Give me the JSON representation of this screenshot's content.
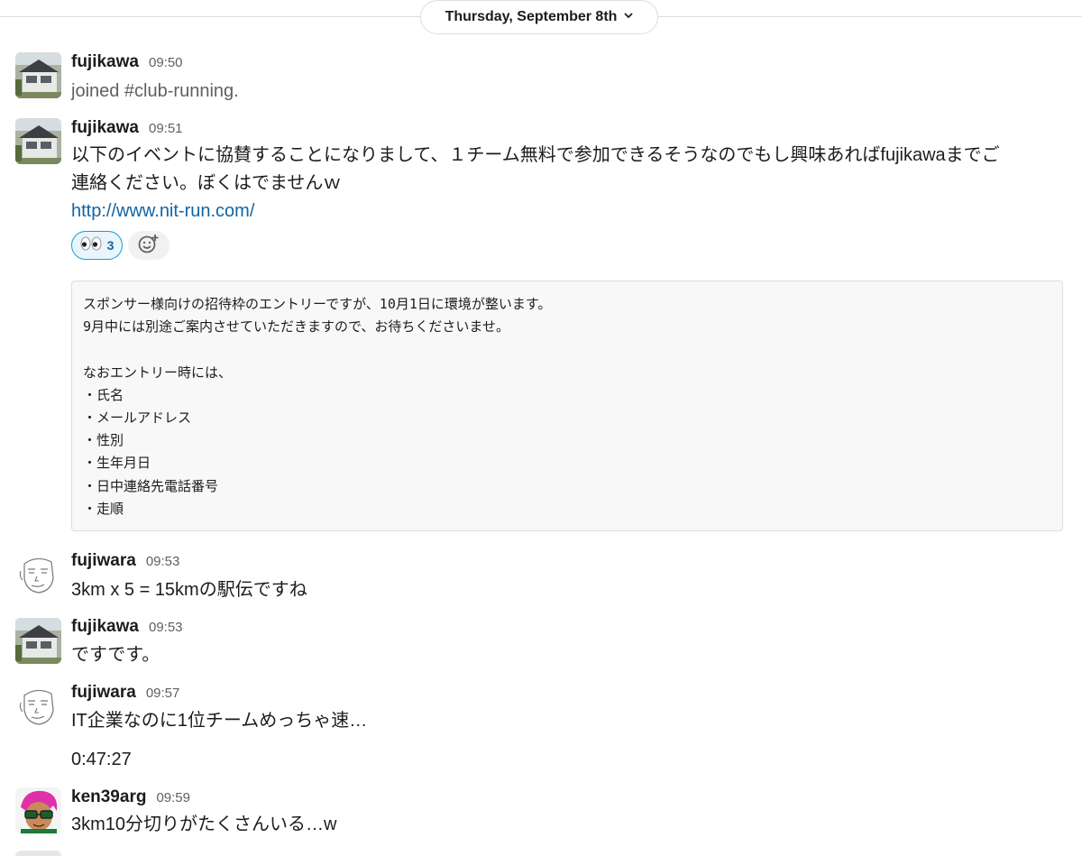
{
  "date_divider": {
    "label": "Thursday, September 8th"
  },
  "messages": [
    {
      "user": "fujikawa",
      "time": "09:50",
      "text": "joined #club-running."
    },
    {
      "user": "fujikawa",
      "time": "09:51",
      "lines": [
        "以下のイベントに協賛することになりまして、１チーム無料で参加できるそうなのでもし興味あればfujikawaまでご",
        "連絡ください。ぼくはでませんｗ"
      ],
      "link": "http://www.nit-run.com/",
      "reaction": {
        "emoji": "eyes",
        "count": "3"
      },
      "code_lines": [
        "スポンサー様向けの招待枠のエントリーですが、10月1日に環境が整います。",
        "9月中には別途ご案内させていただきますので、お待ちくださいませ。",
        "",
        "なおエントリー時には、",
        "・氏名",
        "・メールアドレス",
        "・性別",
        "・生年月日",
        "・日中連絡先電話番号",
        "・走順"
      ]
    },
    {
      "user": "fujiwara",
      "time": "09:53",
      "text": "3km x 5 = 15kmの駅伝ですね"
    },
    {
      "user": "fujikawa",
      "time": "09:53",
      "text": "ですです。"
    },
    {
      "user": "fujiwara",
      "time": "09:57",
      "text": "IT企業なのに1位チームめっちゃ速…",
      "text2": "0:47:27"
    },
    {
      "user": "ken39arg",
      "time": "09:59",
      "text": "3km10分切りがたくさんいる…w"
    }
  ],
  "icons": {
    "date_chevron": "chevron-down-icon",
    "reaction_emoji": "eyes-emoji-icon",
    "add_reaction": "add-reaction-icon"
  },
  "colors": {
    "link": "#1264a3",
    "reaction_border": "#1d9bd1",
    "reaction_bg": "#e8f5fa",
    "muted": "#616061"
  }
}
